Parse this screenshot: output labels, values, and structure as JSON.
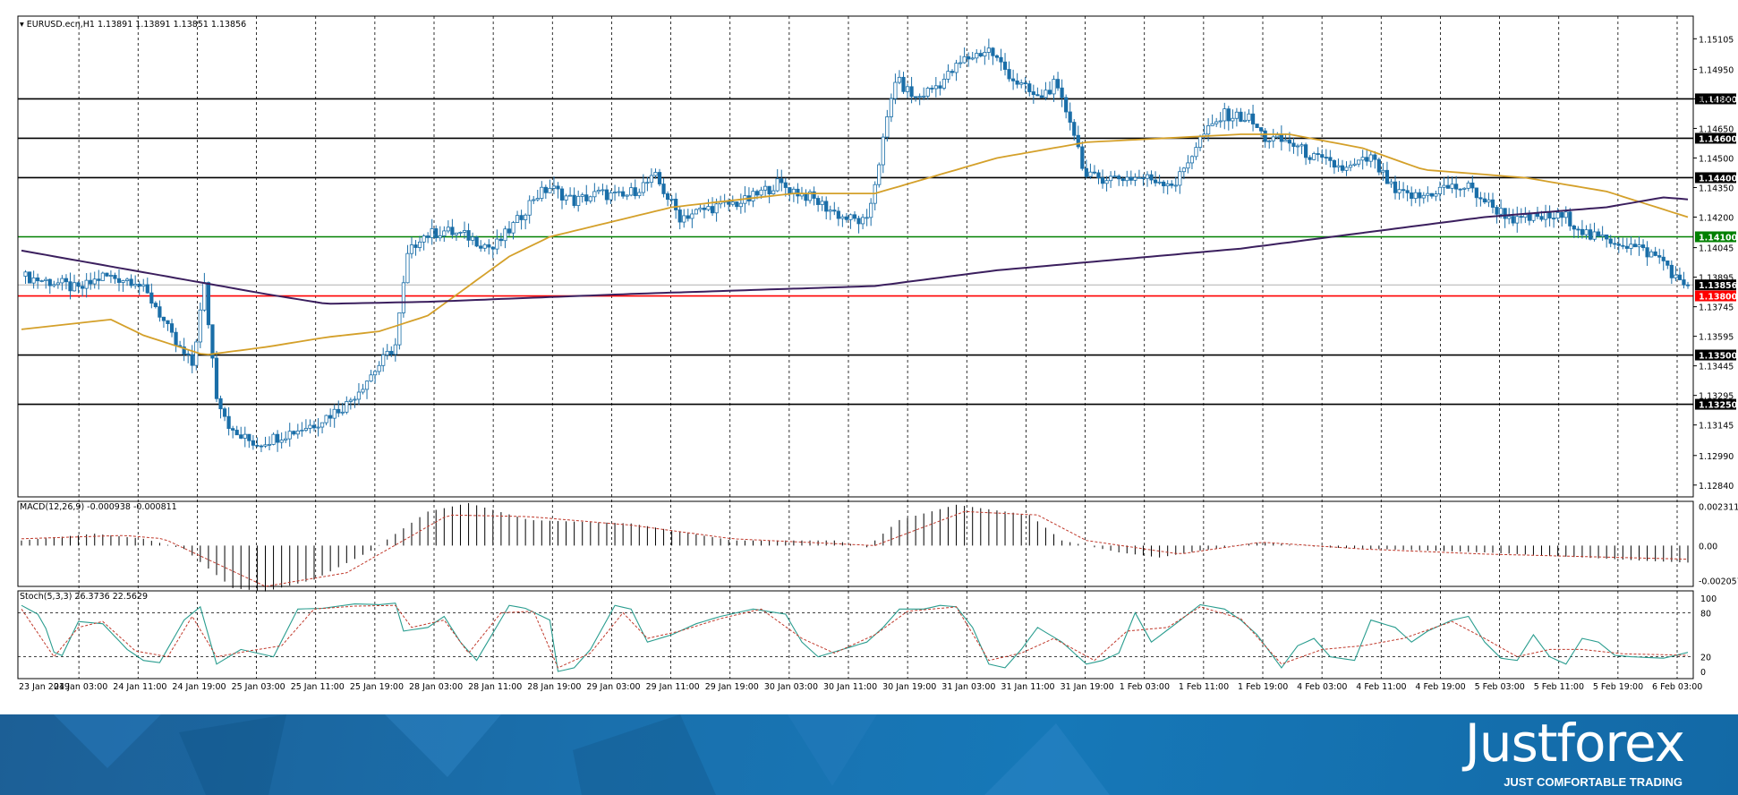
{
  "chart_data": {
    "type": "candlestick",
    "symbol_header": "EURUSD.ecn,H1  1.13891 1.13891 1.13851 1.13856",
    "current_price": "1.13856",
    "y_ticks": [
      "1.15105",
      "1.14950",
      "1.14800",
      "1.14650",
      "1.14500",
      "1.14350",
      "1.14200",
      "1.14045",
      "1.13895",
      "1.13745",
      "1.13595",
      "1.13445",
      "1.13295",
      "1.13145",
      "1.12990",
      "1.12840"
    ],
    "ylim": [
      1.1278,
      1.1522
    ],
    "x_labels": [
      "23 Jan 2019",
      "24 Jan 03:00",
      "24 Jan 11:00",
      "24 Jan 19:00",
      "25 Jan 03:00",
      "25 Jan 11:00",
      "25 Jan 19:00",
      "28 Jan 03:00",
      "28 Jan 11:00",
      "28 Jan 19:00",
      "29 Jan 03:00",
      "29 Jan 11:00",
      "29 Jan 19:00",
      "30 Jan 03:00",
      "30 Jan 11:00",
      "30 Jan 19:00",
      "31 Jan 03:00",
      "31 Jan 11:00",
      "31 Jan 19:00",
      "1 Feb 03:00",
      "1 Feb 11:00",
      "1 Feb 19:00",
      "4 Feb 03:00",
      "4 Feb 11:00",
      "4 Feb 19:00",
      "5 Feb 03:00",
      "5 Feb 11:00",
      "5 Feb 19:00",
      "6 Feb 03:00"
    ],
    "levels": [
      {
        "label": "1.14800",
        "value": 1.148,
        "color": "#000000"
      },
      {
        "label": "1.14600",
        "value": 1.146,
        "color": "#000000"
      },
      {
        "label": "1.14400",
        "value": 1.144,
        "color": "#000000"
      },
      {
        "label": "1.14100",
        "value": 1.141,
        "color": "#008000"
      },
      {
        "label": "1.13800",
        "value": 1.138,
        "color": "#ff0000"
      },
      {
        "label": "1.13500",
        "value": 1.135,
        "color": "#000000"
      },
      {
        "label": "1.13250",
        "value": 1.1325,
        "color": "#000000"
      }
    ],
    "close_path": [
      [
        0,
        1.139
      ],
      [
        10,
        1.1386
      ],
      [
        14,
        1.1383
      ],
      [
        20,
        1.139
      ],
      [
        28,
        1.1388
      ],
      [
        33,
        1.1375
      ],
      [
        38,
        1.1355
      ],
      [
        42,
        1.1345
      ],
      [
        45,
        1.1385
      ],
      [
        48,
        1.133
      ],
      [
        52,
        1.131
      ],
      [
        58,
        1.1305
      ],
      [
        65,
        1.131
      ],
      [
        72,
        1.1315
      ],
      [
        80,
        1.1325
      ],
      [
        88,
        1.1345
      ],
      [
        92,
        1.1355
      ],
      [
        95,
        1.14
      ],
      [
        98,
        1.141
      ],
      [
        104,
        1.1413
      ],
      [
        110,
        1.141
      ],
      [
        116,
        1.1404
      ],
      [
        122,
        1.1418
      ],
      [
        126,
        1.143
      ],
      [
        130,
        1.1435
      ],
      [
        136,
        1.1428
      ],
      [
        142,
        1.1432
      ],
      [
        148,
        1.143
      ],
      [
        156,
        1.144
      ],
      [
        162,
        1.142
      ],
      [
        170,
        1.1425
      ],
      [
        178,
        1.1428
      ],
      [
        186,
        1.1437
      ],
      [
        194,
        1.143
      ],
      [
        202,
        1.142
      ],
      [
        208,
        1.1417
      ],
      [
        215,
        1.149
      ],
      [
        220,
        1.148
      ],
      [
        226,
        1.1488
      ],
      [
        232,
        1.15
      ],
      [
        238,
        1.1505
      ],
      [
        244,
        1.149
      ],
      [
        250,
        1.148
      ],
      [
        254,
        1.1487
      ],
      [
        258,
        1.147
      ],
      [
        262,
        1.144
      ],
      [
        268,
        1.144
      ],
      [
        276,
        1.144
      ],
      [
        284,
        1.1437
      ],
      [
        290,
        1.146
      ],
      [
        296,
        1.1472
      ],
      [
        302,
        1.147
      ],
      [
        306,
        1.146
      ],
      [
        312,
        1.1458
      ],
      [
        318,
        1.145
      ],
      [
        326,
        1.1444
      ],
      [
        332,
        1.145
      ],
      [
        338,
        1.1432
      ],
      [
        344,
        1.143
      ],
      [
        350,
        1.1435
      ],
      [
        356,
        1.1435
      ],
      [
        362,
        1.1425
      ],
      [
        368,
        1.1418
      ],
      [
        374,
        1.142
      ],
      [
        380,
        1.142
      ],
      [
        386,
        1.141
      ],
      [
        392,
        1.1408
      ],
      [
        398,
        1.1404
      ],
      [
        404,
        1.1398
      ],
      [
        408,
        1.1386
      ]
    ],
    "ma_fast_path": [
      [
        0,
        1.1363
      ],
      [
        22,
        1.1368
      ],
      [
        30,
        1.136
      ],
      [
        45,
        1.135
      ],
      [
        60,
        1.1354
      ],
      [
        75,
        1.1359
      ],
      [
        88,
        1.1362
      ],
      [
        100,
        1.137
      ],
      [
        120,
        1.14
      ],
      [
        130,
        1.141
      ],
      [
        160,
        1.1425
      ],
      [
        190,
        1.1432
      ],
      [
        210,
        1.1432
      ],
      [
        240,
        1.145
      ],
      [
        262,
        1.1458
      ],
      [
        300,
        1.1462
      ],
      [
        312,
        1.1462
      ],
      [
        330,
        1.1455
      ],
      [
        345,
        1.1444
      ],
      [
        370,
        1.144
      ],
      [
        390,
        1.1433
      ],
      [
        410,
        1.142
      ]
    ],
    "ma_slow_path": [
      [
        0,
        1.1403
      ],
      [
        30,
        1.1392
      ],
      [
        60,
        1.1381
      ],
      [
        75,
        1.1376
      ],
      [
        100,
        1.1377
      ],
      [
        150,
        1.1381
      ],
      [
        210,
        1.1385
      ],
      [
        240,
        1.1393
      ],
      [
        300,
        1.1404
      ],
      [
        360,
        1.142
      ],
      [
        390,
        1.1425
      ],
      [
        404,
        1.143
      ],
      [
        410,
        1.1429
      ]
    ],
    "macd_label": "MACD(12,26,9) -0.000938 -0.000811",
    "macd_ticks": [
      "0.002311",
      "0.00",
      "-0.002057"
    ],
    "macd_ylim": [
      -0.0024,
      0.0026
    ],
    "macd_hist_path": [
      [
        0,
        0.0003
      ],
      [
        18,
        0.0007
      ],
      [
        30,
        0.0004
      ],
      [
        40,
        -0.0002
      ],
      [
        52,
        -0.0025
      ],
      [
        60,
        -0.0027
      ],
      [
        72,
        -0.002
      ],
      [
        86,
        -0.0003
      ],
      [
        100,
        0.002
      ],
      [
        110,
        0.0025
      ],
      [
        125,
        0.0015
      ],
      [
        150,
        0.0013
      ],
      [
        175,
        0.0003
      ],
      [
        200,
        0.0003
      ],
      [
        208,
        -0.0001
      ],
      [
        216,
        0.0015
      ],
      [
        230,
        0.0024
      ],
      [
        248,
        0.0018
      ],
      [
        256,
        0.0003
      ],
      [
        270,
        -0.0004
      ],
      [
        280,
        -0.0007
      ],
      [
        290,
        -0.0003
      ],
      [
        305,
        0.0002
      ],
      [
        320,
        -0.0001
      ],
      [
        360,
        -0.0004
      ],
      [
        400,
        -0.0009
      ],
      [
        410,
        -0.001
      ]
    ],
    "macd_signal_path": [
      [
        0,
        0.0004
      ],
      [
        25,
        0.0006
      ],
      [
        35,
        0.0004
      ],
      [
        60,
        -0.0024
      ],
      [
        80,
        -0.0016
      ],
      [
        105,
        0.0018
      ],
      [
        125,
        0.0017
      ],
      [
        150,
        0.0012
      ],
      [
        175,
        0.0004
      ],
      [
        210,
        0.0
      ],
      [
        232,
        0.002
      ],
      [
        250,
        0.0018
      ],
      [
        262,
        0.0003
      ],
      [
        285,
        -0.0005
      ],
      [
        305,
        0.0002
      ],
      [
        330,
        -0.0002
      ],
      [
        360,
        -0.0005
      ],
      [
        410,
        -0.0008
      ]
    ],
    "stoch_label": "Stoch(5,3,3) 26.3736 22.5629",
    "stoch_ticks": [
      "100",
      "80",
      "20",
      "0"
    ],
    "stoch_main_path": [
      [
        0,
        90
      ],
      [
        5,
        75
      ],
      [
        9,
        10
      ],
      [
        14,
        68
      ],
      [
        20,
        65
      ],
      [
        26,
        30
      ],
      [
        30,
        15
      ],
      [
        34,
        12
      ],
      [
        40,
        70
      ],
      [
        44,
        88
      ],
      [
        48,
        10
      ],
      [
        54,
        30
      ],
      [
        58,
        25
      ],
      [
        62,
        20
      ],
      [
        68,
        85
      ],
      [
        74,
        86
      ],
      [
        82,
        92
      ],
      [
        88,
        91
      ],
      [
        92,
        93
      ],
      [
        94,
        55
      ],
      [
        100,
        60
      ],
      [
        104,
        75
      ],
      [
        108,
        40
      ],
      [
        112,
        15
      ],
      [
        120,
        90
      ],
      [
        124,
        86
      ],
      [
        130,
        70
      ],
      [
        132,
        0
      ],
      [
        136,
        5
      ],
      [
        140,
        30
      ],
      [
        146,
        90
      ],
      [
        150,
        85
      ],
      [
        154,
        40
      ],
      [
        160,
        50
      ],
      [
        166,
        65
      ],
      [
        172,
        75
      ],
      [
        180,
        85
      ],
      [
        188,
        78
      ],
      [
        192,
        40
      ],
      [
        196,
        20
      ],
      [
        202,
        30
      ],
      [
        208,
        40
      ],
      [
        212,
        60
      ],
      [
        216,
        85
      ],
      [
        222,
        85
      ],
      [
        226,
        90
      ],
      [
        230,
        88
      ],
      [
        234,
        60
      ],
      [
        238,
        10
      ],
      [
        242,
        5
      ],
      [
        246,
        30
      ],
      [
        250,
        60
      ],
      [
        256,
        40
      ],
      [
        262,
        10
      ],
      [
        266,
        15
      ],
      [
        270,
        25
      ],
      [
        274,
        80
      ],
      [
        278,
        40
      ],
      [
        284,
        65
      ],
      [
        290,
        91
      ],
      [
        296,
        85
      ],
      [
        300,
        70
      ],
      [
        304,
        50
      ],
      [
        310,
        5
      ],
      [
        314,
        35
      ],
      [
        318,
        45
      ],
      [
        322,
        20
      ],
      [
        328,
        15
      ],
      [
        332,
        70
      ],
      [
        338,
        60
      ],
      [
        342,
        40
      ],
      [
        346,
        55
      ],
      [
        352,
        70
      ],
      [
        356,
        75
      ],
      [
        360,
        40
      ],
      [
        364,
        18
      ],
      [
        368,
        15
      ],
      [
        372,
        50
      ],
      [
        376,
        20
      ],
      [
        380,
        10
      ],
      [
        384,
        45
      ],
      [
        388,
        40
      ],
      [
        392,
        22
      ],
      [
        396,
        20
      ],
      [
        404,
        18
      ],
      [
        410,
        26
      ]
    ],
    "stoch_signal_path": [
      [
        0,
        85
      ],
      [
        8,
        20
      ],
      [
        14,
        60
      ],
      [
        20,
        68
      ],
      [
        28,
        28
      ],
      [
        36,
        20
      ],
      [
        42,
        75
      ],
      [
        48,
        20
      ],
      [
        56,
        28
      ],
      [
        64,
        35
      ],
      [
        72,
        85
      ],
      [
        82,
        89
      ],
      [
        92,
        90
      ],
      [
        96,
        60
      ],
      [
        104,
        70
      ],
      [
        110,
        25
      ],
      [
        118,
        80
      ],
      [
        126,
        82
      ],
      [
        132,
        5
      ],
      [
        140,
        25
      ],
      [
        148,
        80
      ],
      [
        154,
        45
      ],
      [
        162,
        55
      ],
      [
        172,
        72
      ],
      [
        182,
        85
      ],
      [
        192,
        45
      ],
      [
        200,
        25
      ],
      [
        210,
        50
      ],
      [
        218,
        82
      ],
      [
        230,
        88
      ],
      [
        238,
        15
      ],
      [
        246,
        25
      ],
      [
        254,
        45
      ],
      [
        264,
        15
      ],
      [
        272,
        55
      ],
      [
        282,
        60
      ],
      [
        290,
        88
      ],
      [
        300,
        72
      ],
      [
        310,
        10
      ],
      [
        320,
        30
      ],
      [
        330,
        35
      ],
      [
        340,
        45
      ],
      [
        352,
        68
      ],
      [
        360,
        45
      ],
      [
        368,
        20
      ],
      [
        376,
        30
      ],
      [
        384,
        30
      ],
      [
        394,
        24
      ],
      [
        410,
        22
      ]
    ]
  },
  "brand": {
    "logo_text": "Justforex",
    "tagline": "JUST COMFORTABLE TRADING"
  },
  "colors": {
    "bull": "#ffffff",
    "bear": "#1a6ea8",
    "candle_outline": "#1a6ea8",
    "ma_fast": "#d4a02a",
    "ma_slow": "#3b1f5e",
    "macd_signal": "#c0392b",
    "stoch_main": "#2a9d8f",
    "stoch_signal": "#c0392b"
  }
}
